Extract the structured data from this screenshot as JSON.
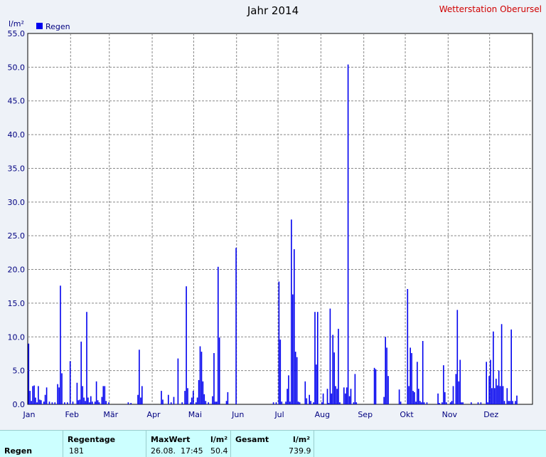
{
  "header": {
    "title": "Jahr 2014",
    "station": "Wetterstation Oberursel"
  },
  "chart_data": {
    "type": "bar",
    "title": "Jahr 2014",
    "ylabel": "l/m²",
    "ylim": [
      0,
      55
    ],
    "y_ticks": [
      "0.0",
      "5.0",
      "10.0",
      "15.0",
      "20.0",
      "25.0",
      "30.0",
      "35.0",
      "40.0",
      "45.0",
      "50.0",
      "55.0"
    ],
    "x_ticks": [
      "Jan",
      "Feb",
      "Mär",
      "Apr",
      "Mai",
      "Jun",
      "Jul",
      "Aug",
      "Sep",
      "Okt",
      "Nov",
      "Dez"
    ],
    "grid": true,
    "legend": "top-left",
    "color": "#0000ee",
    "series": [
      {
        "name": "Regen",
        "points": [
          [
            1,
            9.0
          ],
          [
            2,
            2.0
          ],
          [
            3,
            0.5
          ],
          [
            4,
            2.7
          ],
          [
            5,
            2.8
          ],
          [
            6,
            1.0
          ],
          [
            7,
            0.3
          ],
          [
            8,
            2.7
          ],
          [
            9,
            0.7
          ],
          [
            10,
            0.6
          ],
          [
            12,
            0.4
          ],
          [
            13,
            1.4
          ],
          [
            14,
            2.5
          ],
          [
            16,
            0.4
          ],
          [
            18,
            0.3
          ],
          [
            20,
            0.3
          ],
          [
            22,
            3.0
          ],
          [
            23,
            2.5
          ],
          [
            24,
            17.6
          ],
          [
            25,
            4.6
          ],
          [
            27,
            0.3
          ],
          [
            29,
            0.3
          ],
          [
            31,
            6.4
          ],
          [
            33,
            0.4
          ],
          [
            36,
            3.2
          ],
          [
            37,
            0.6
          ],
          [
            38,
            0.7
          ],
          [
            39,
            9.3
          ],
          [
            40,
            2.7
          ],
          [
            41,
            1.0
          ],
          [
            42,
            0.5
          ],
          [
            43,
            13.7
          ],
          [
            44,
            1.0
          ],
          [
            45,
            0.3
          ],
          [
            46,
            1.2
          ],
          [
            47,
            0.4
          ],
          [
            49,
            0.4
          ],
          [
            50,
            3.4
          ],
          [
            51,
            0.6
          ],
          [
            52,
            0.3
          ],
          [
            54,
            1.1
          ],
          [
            55,
            2.7
          ],
          [
            56,
            2.7
          ],
          [
            57,
            0.5
          ],
          [
            59,
            0.3
          ],
          [
            73,
            0.3
          ],
          [
            75,
            0.2
          ],
          [
            80,
            1.4
          ],
          [
            81,
            8.1
          ],
          [
            82,
            1.0
          ],
          [
            83,
            2.7
          ],
          [
            97,
            2.0
          ],
          [
            98,
            0.7
          ],
          [
            102,
            1.4
          ],
          [
            104,
            0.3
          ],
          [
            106,
            1.1
          ],
          [
            109,
            6.8
          ],
          [
            112,
            0.3
          ],
          [
            114,
            2.0
          ],
          [
            115,
            17.5
          ],
          [
            116,
            2.4
          ],
          [
            118,
            0.3
          ],
          [
            119,
            1.0
          ],
          [
            120,
            2.0
          ],
          [
            122,
            0.3
          ],
          [
            123,
            1.0
          ],
          [
            124,
            3.6
          ],
          [
            125,
            8.6
          ],
          [
            126,
            7.8
          ],
          [
            127,
            3.4
          ],
          [
            128,
            1.5
          ],
          [
            129,
            0.5
          ],
          [
            131,
            0.3
          ],
          [
            134,
            1.2
          ],
          [
            135,
            7.6
          ],
          [
            136,
            0.4
          ],
          [
            137,
            0.4
          ],
          [
            138,
            20.4
          ],
          [
            139,
            9.9
          ],
          [
            144,
            0.5
          ],
          [
            145,
            1.8
          ],
          [
            151,
            23.2
          ],
          [
            178,
            0.3
          ],
          [
            180,
            0.3
          ],
          [
            182,
            18.2
          ],
          [
            183,
            9.6
          ],
          [
            184,
            0.4
          ],
          [
            187,
            0.4
          ],
          [
            188,
            2.3
          ],
          [
            189,
            4.3
          ],
          [
            190,
            0.4
          ],
          [
            191,
            27.4
          ],
          [
            192,
            16.3
          ],
          [
            193,
            23.0
          ],
          [
            194,
            7.8
          ],
          [
            195,
            7.0
          ],
          [
            196,
            0.4
          ],
          [
            197,
            0.3
          ],
          [
            201,
            3.4
          ],
          [
            202,
            0.9
          ],
          [
            204,
            1.4
          ],
          [
            205,
            0.5
          ],
          [
            207,
            0.3
          ],
          [
            208,
            13.7
          ],
          [
            209,
            5.9
          ],
          [
            210,
            13.7
          ],
          [
            213,
            0.3
          ],
          [
            214,
            1.6
          ],
          [
            217,
            2.3
          ],
          [
            218,
            0.2
          ],
          [
            219,
            14.2
          ],
          [
            220,
            1.6
          ],
          [
            221,
            10.3
          ],
          [
            222,
            7.7
          ],
          [
            223,
            2.7
          ],
          [
            224,
            2.3
          ],
          [
            225,
            11.2
          ],
          [
            226,
            0.3
          ],
          [
            229,
            2.5
          ],
          [
            230,
            1.6
          ],
          [
            231,
            2.5
          ],
          [
            232,
            50.4
          ],
          [
            233,
            1.2
          ],
          [
            234,
            2.3
          ],
          [
            236,
            0.3
          ],
          [
            237,
            4.5
          ],
          [
            238,
            0.3
          ],
          [
            251,
            5.4
          ],
          [
            252,
            5.2
          ],
          [
            258,
            1.1
          ],
          [
            259,
            10.0
          ],
          [
            260,
            8.4
          ],
          [
            261,
            4.2
          ],
          [
            269,
            2.2
          ],
          [
            270,
            0.4
          ],
          [
            275,
            17.1
          ],
          [
            276,
            2.7
          ],
          [
            277,
            8.4
          ],
          [
            278,
            7.6
          ],
          [
            279,
            2.0
          ],
          [
            280,
            1.8
          ],
          [
            281,
            0.4
          ],
          [
            282,
            6.3
          ],
          [
            283,
            2.3
          ],
          [
            284,
            0.5
          ],
          [
            285,
            0.3
          ],
          [
            286,
            9.4
          ],
          [
            287,
            0.3
          ],
          [
            289,
            0.3
          ],
          [
            297,
            1.6
          ],
          [
            298,
            0.2
          ],
          [
            300,
            0.3
          ],
          [
            301,
            5.8
          ],
          [
            302,
            1.8
          ],
          [
            303,
            0.3
          ],
          [
            306,
            0.3
          ],
          [
            307,
            0.5
          ],
          [
            308,
            2.7
          ],
          [
            310,
            4.5
          ],
          [
            311,
            14.0
          ],
          [
            312,
            3.4
          ],
          [
            313,
            6.6
          ],
          [
            314,
            0.3
          ],
          [
            315,
            0.3
          ],
          [
            321,
            0.3
          ],
          [
            326,
            0.3
          ],
          [
            328,
            0.3
          ],
          [
            332,
            6.3
          ],
          [
            333,
            0.3
          ],
          [
            334,
            4.2
          ],
          [
            335,
            6.6
          ],
          [
            336,
            2.4
          ],
          [
            337,
            10.8
          ],
          [
            338,
            2.4
          ],
          [
            339,
            3.8
          ],
          [
            340,
            2.8
          ],
          [
            341,
            5.0
          ],
          [
            342,
            2.7
          ],
          [
            343,
            11.9
          ],
          [
            344,
            2.7
          ],
          [
            345,
            0.5
          ],
          [
            347,
            2.4
          ],
          [
            348,
            0.5
          ],
          [
            349,
            0.5
          ],
          [
            350,
            11.1
          ],
          [
            351,
            0.5
          ],
          [
            353,
            0.5
          ],
          [
            354,
            1.3
          ]
        ]
      }
    ]
  },
  "table": {
    "row_label": "Regen",
    "col_regentage": "Regentage",
    "col_maxwert": "MaxWert",
    "col_unit1": "l/m²",
    "col_gesamt": "Gesamt",
    "col_unit2": "l/m²",
    "regentage": "181",
    "max_date": "26.08.  17:45",
    "max_value": "50.4",
    "gesamt": "739.9"
  }
}
